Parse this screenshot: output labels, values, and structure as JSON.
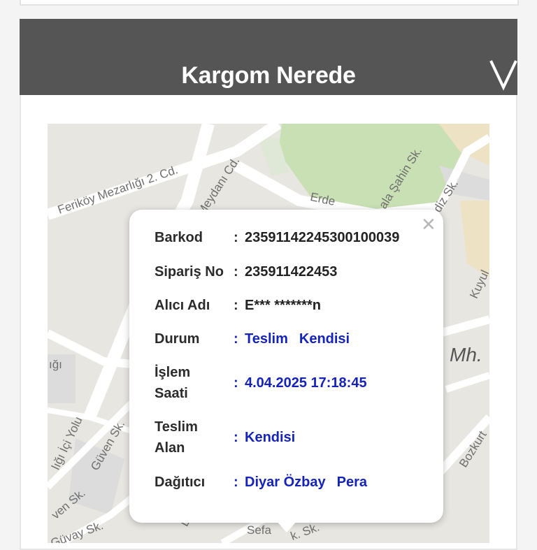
{
  "panel": {
    "title": "Kargom Nerede",
    "toggle_icon": "chevron-down-icon"
  },
  "map": {
    "street_labels": [
      "Feriköy Mezarlığı 2. Cd.",
      "Meydanı Cd.",
      "Erde",
      "ala Şahin Sk.",
      "diz Sk.",
      "Kuyul",
      "Mh.",
      "ığı",
      "lığı İçi Yolu",
      "Güven Sk.",
      "ven Sk.",
      "Bozkurt",
      "Sefa",
      "k. Sk.",
      "Güvay Sk.",
      "D"
    ],
    "colors": {
      "base": "#e8e6e1",
      "road": "#ffffff",
      "park": "#c9e0b4",
      "block": "#dcdcdc",
      "tan": "#eee2c5"
    }
  },
  "popup": {
    "close_icon": "close-icon",
    "rows": [
      {
        "label": "Barkod",
        "value": "23591142245300100039"
      },
      {
        "label": "Sipariş No",
        "value": "235911422453"
      },
      {
        "label": "Alıcı Adı",
        "value": "E*** *******n"
      },
      {
        "label": "Durum",
        "value_a": "Teslim",
        "value_b": "Kendisi"
      },
      {
        "label_line1": "İşlem",
        "label_line2": "Saati",
        "value": "4.04.2025 17:18:45"
      },
      {
        "label_line1": "Teslim",
        "label_line2": "Alan",
        "value": "Kendisi"
      },
      {
        "label": "Dağıtıcı",
        "value_a": "Diyar Özbay",
        "value_b": "Pera"
      }
    ],
    "colon": ":"
  }
}
